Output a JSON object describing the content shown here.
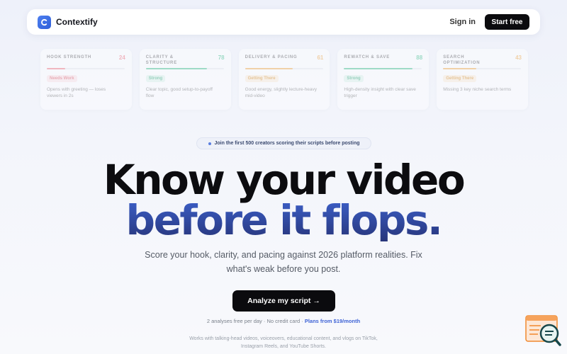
{
  "nav": {
    "brand": "Contextify",
    "sign_in": "Sign in",
    "start_free": "Start free"
  },
  "cards": [
    {
      "title": "HOOK STRENGTH",
      "score": "24",
      "progress": 0.24,
      "color": "#f0707a",
      "badge": "Needs Work",
      "badge_bg": "#fde3e6",
      "badge_color": "#e05a66",
      "desc": "Opens with greeting — loses viewers in 2s"
    },
    {
      "title": "CLARITY & STRUCTURE",
      "score": "78",
      "progress": 0.78,
      "color": "#3dbf88",
      "badge": "Strong",
      "badge_bg": "#dcf5ea",
      "badge_color": "#2ea676",
      "desc": "Clear topic, good setup-to-payoff flow"
    },
    {
      "title": "DELIVERY & PACING",
      "score": "61",
      "progress": 0.61,
      "color": "#f0a945",
      "badge": "Getting There",
      "badge_bg": "#fdeed8",
      "badge_color": "#d98e24",
      "desc": "Good energy, slightly lecture-heavy mid-video"
    },
    {
      "title": "REWATCH & SAVE",
      "score": "88",
      "progress": 0.88,
      "color": "#3dbf88",
      "badge": "Strong",
      "badge_bg": "#dcf5ea",
      "badge_color": "#2ea676",
      "desc": "High-density insight with clear save trigger"
    },
    {
      "title": "SEARCH OPTIMIZATION",
      "score": "43",
      "progress": 0.43,
      "color": "#f0a945",
      "badge": "Getting There",
      "badge_bg": "#fdeed8",
      "badge_color": "#d98e24",
      "desc": "Missing 3 key niche search terms"
    }
  ],
  "hero": {
    "pill": "Join the first 500 creators scoring their scripts before posting",
    "headline_1": "Know your video",
    "headline_2": "before it flops.",
    "subtitle": "Score your hook, clarity, and pacing against 2026 platform realities. Fix what's weak before you post.",
    "cta": "Analyze my script →",
    "meta_text": "2 analyses free per day · No credit card · ",
    "plans_link": "Plans from $19/month",
    "works_with": "Works with talking-head videos, voiceovers, educational content, and vlogs on TikTok, Instagram Reels, and YouTube Shorts."
  },
  "widget": {
    "icon": "chat-search-icon"
  }
}
